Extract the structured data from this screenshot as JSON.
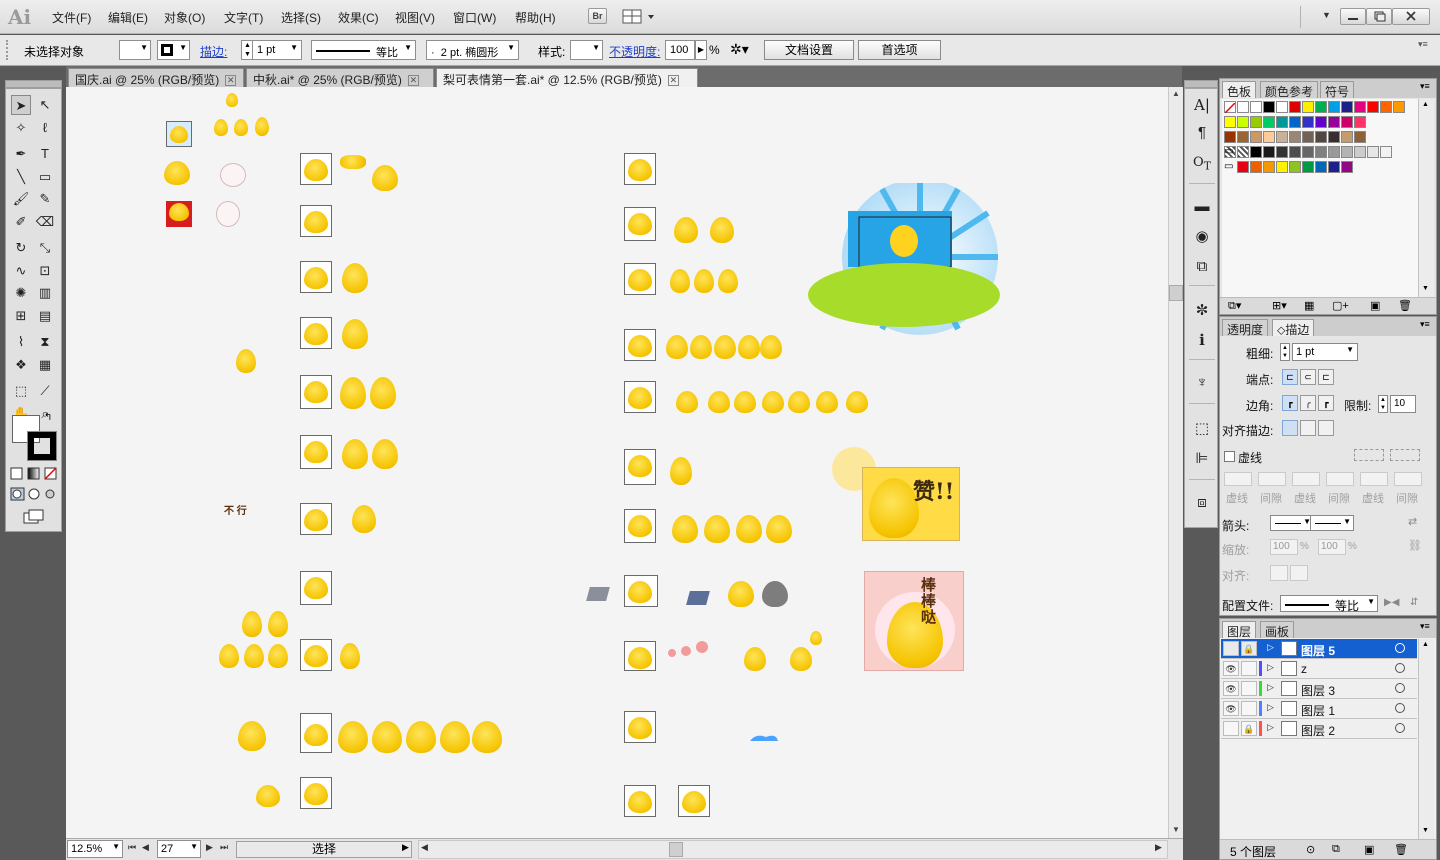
{
  "app": {
    "logo": "Ai",
    "bridge_label": "Br"
  },
  "menus": [
    "文件(F)",
    "编辑(E)",
    "对象(O)",
    "文字(T)",
    "选择(S)",
    "效果(C)",
    "视图(V)",
    "窗口(W)",
    "帮助(H)"
  ],
  "control_bar": {
    "selection_status": "未选择对象",
    "stroke_label": "描边:",
    "stroke_weight": "1 pt",
    "stroke_profile": "等比",
    "brush": "2 pt. 椭圆形",
    "brush_dot": "·",
    "style_label": "样式:",
    "opacity_label": "不透明度:",
    "opacity_value": "100",
    "opacity_unit": "%",
    "doc_settings": "文档设置",
    "preferences": "首选项"
  },
  "tabs": [
    {
      "label": "国庆.ai @ 25% (RGB/预览)",
      "active": false
    },
    {
      "label": "中秋.ai* @ 25% (RGB/预览)",
      "active": false
    },
    {
      "label": "梨可表情第一套.ai* @ 12.5% (RGB/预览)",
      "active": true
    }
  ],
  "tools": [
    "selection-tool",
    "direct-selection-tool",
    "magic-wand-tool",
    "lasso-tool",
    "pen-tool",
    "type-tool",
    "line-tool",
    "rectangle-tool",
    "paintbrush-tool",
    "pencil-tool",
    "blob-brush-tool",
    "eraser-tool",
    "rotate-tool",
    "scale-tool",
    "warp-tool",
    "free-transform-tool",
    "symbol-sprayer-tool",
    "column-graph-tool",
    "mesh-tool",
    "gradient-tool",
    "eyedropper-tool",
    "blend-tool",
    "symbol-tool",
    "bar-graph-tool",
    "artboard-tool",
    "slice-tool",
    "hand-tool",
    "zoom-tool"
  ],
  "canvas": {
    "text_labels": {
      "bu_xing": "不 行",
      "zan": "赞!!",
      "bang": "棒棒哒"
    }
  },
  "status_bar": {
    "zoom": "12.5%",
    "artboard_number": "27",
    "status_text": "选择"
  },
  "swatches_panel": {
    "tabs": [
      "色板",
      "颜色参考",
      "符号"
    ],
    "row1": [
      "#000000",
      "#ffffff",
      "#e10000",
      "#ffee00",
      "#00b050",
      "#00a0e9",
      "#1d2088",
      "#e4007f",
      "#ff0000",
      "#ff6600",
      "#ff9900"
    ],
    "row2": [
      "#ffff00",
      "#ccff00",
      "#99cc00",
      "#00cc66",
      "#009999",
      "#0066cc",
      "#3333cc",
      "#6600cc",
      "#990099",
      "#cc0066",
      "#ff3366"
    ],
    "row3": [
      "#993300",
      "#996633",
      "#cc9966",
      "#ffcc99",
      "#c7b299",
      "#998675",
      "#736357",
      "#534741",
      "#362f2d",
      "#c69c6d",
      "#8c6239"
    ],
    "row4": [
      "#000000",
      "#1a1a1a",
      "#333333",
      "#4d4d4d",
      "#666666",
      "#808080",
      "#999999",
      "#b3b3b3",
      "#cccccc",
      "#e6e6e6",
      "#f2f2f2"
    ],
    "row5": [
      "#e60012",
      "#eb6100",
      "#f39800",
      "#fff100",
      "#8fc31f",
      "#009944",
      "#0068b7",
      "#1d2088",
      "#920783"
    ]
  },
  "stroke_panel": {
    "tabs": [
      "透明度",
      "描边"
    ],
    "weight_label": "粗细:",
    "weight_value": "1 pt",
    "cap_label": "端点:",
    "corner_label": "边角:",
    "limit_label": "限制:",
    "limit_value": "10",
    "align_label": "对齐描边:",
    "dashed_label": "虚线",
    "dash_labels": [
      "虚线",
      "间隙",
      "虚线",
      "间隙",
      "虚线",
      "间隙"
    ],
    "arrow_label": "箭头:",
    "scale_label": "缩放:",
    "scale_value_1": "100",
    "scale_value_2": "100",
    "pct": "%",
    "align_arrow_label": "对齐:",
    "profile_label": "配置文件:",
    "profile_value": "等比"
  },
  "layers_panel": {
    "tabs": [
      "图层",
      "画板"
    ],
    "layers": [
      {
        "name": "图层 5",
        "color": "#1560d1",
        "visible": false,
        "locked": true,
        "selected": true
      },
      {
        "name": "z",
        "color": "#4f4fff",
        "visible": true,
        "locked": false,
        "selected": false
      },
      {
        "name": "图层 3",
        "color": "#39d939",
        "visible": true,
        "locked": false,
        "selected": false
      },
      {
        "name": "图层 1",
        "color": "#4f7fff",
        "visible": true,
        "locked": false,
        "selected": false
      },
      {
        "name": "图层 2",
        "color": "#ff4f4f",
        "visible": false,
        "locked": true,
        "selected": false
      }
    ],
    "count": "5 个图层"
  }
}
